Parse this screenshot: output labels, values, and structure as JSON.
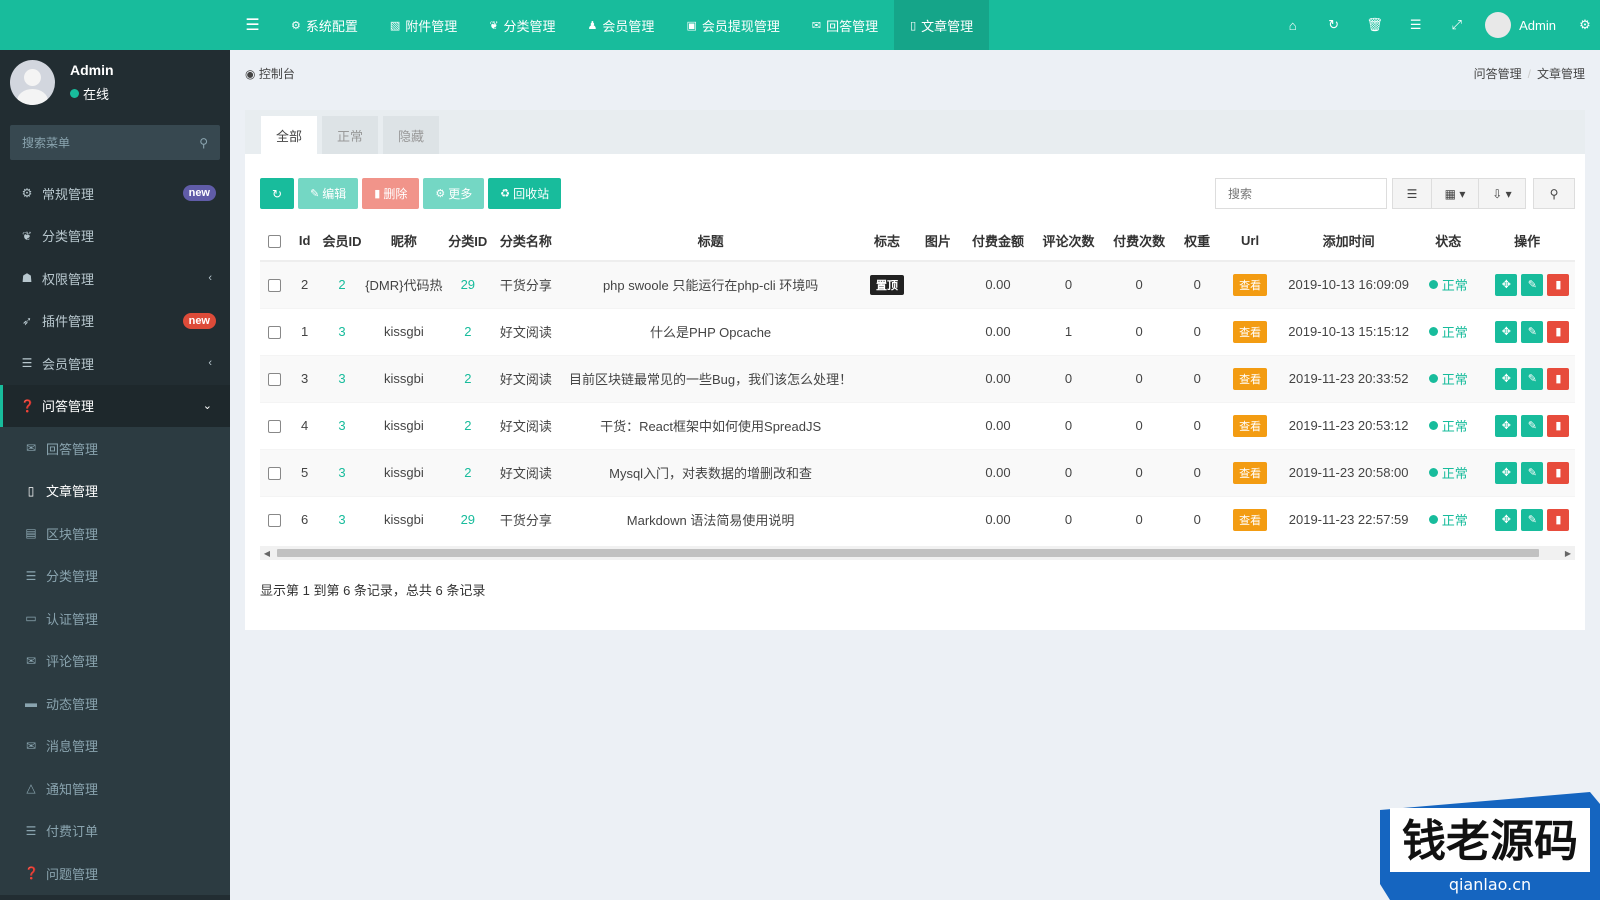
{
  "theme": {
    "primary": "#18bc9c",
    "sidebar_bg": "#222d32",
    "badge_new": "#605ca8",
    "badge_red": "#dd4b39",
    "warning": "#f39c12",
    "danger": "#e74c3c"
  },
  "header": {
    "tabs": [
      {
        "label": "系统配置",
        "icon": "gear-icon"
      },
      {
        "label": "附件管理",
        "icon": "file-image-icon"
      },
      {
        "label": "分类管理",
        "icon": "leaf-icon"
      },
      {
        "label": "会员管理",
        "icon": "user-icon"
      },
      {
        "label": "会员提现管理",
        "icon": "money-icon"
      },
      {
        "label": "回答管理",
        "icon": "comment-icon"
      },
      {
        "label": "文章管理",
        "icon": "file-icon"
      }
    ],
    "active_tab": "文章管理",
    "admin_name": "Admin"
  },
  "sidebar": {
    "user_name": "Admin",
    "user_status": "在线",
    "search_placeholder": "搜索菜单",
    "items": [
      {
        "label": "常规管理",
        "icon": "cogs-icon",
        "badge": "new"
      },
      {
        "label": "分类管理",
        "icon": "leaf-icon"
      },
      {
        "label": "权限管理",
        "icon": "group-icon"
      },
      {
        "label": "插件管理",
        "icon": "rocket-icon",
        "badge": "new"
      },
      {
        "label": "会员管理",
        "icon": "list-icon"
      },
      {
        "label": "问答管理",
        "icon": "question-icon"
      }
    ],
    "subitems": [
      {
        "label": "回答管理",
        "icon": "comment-icon"
      },
      {
        "label": "文章管理",
        "icon": "file-icon"
      },
      {
        "label": "区块管理",
        "icon": "block-icon"
      },
      {
        "label": "分类管理",
        "icon": "list-icon"
      },
      {
        "label": "认证管理",
        "icon": "id-card-icon"
      },
      {
        "label": "评论管理",
        "icon": "comments-icon"
      },
      {
        "label": "动态管理",
        "icon": "feed-icon"
      },
      {
        "label": "消息管理",
        "icon": "message-icon"
      },
      {
        "label": "通知管理",
        "icon": "bell-icon"
      },
      {
        "label": "付费订单",
        "icon": "list-icon"
      },
      {
        "label": "问题管理",
        "icon": "question-icon"
      }
    ]
  },
  "content": {
    "page_label": "控制台",
    "breadcrumb": [
      "问答管理",
      "文章管理"
    ],
    "tabs": [
      "全部",
      "正常",
      "隐藏"
    ],
    "toolbar": {
      "edit": "编辑",
      "delete": "删除",
      "more": "更多",
      "recycle": "回收站"
    },
    "search_placeholder": "搜索",
    "columns": [
      "Id",
      "会员ID",
      "昵称",
      "分类ID",
      "分类名称",
      "标题",
      "标志",
      "图片",
      "付费金额",
      "评论次数",
      "付费次数",
      "权重",
      "Url",
      "添加时间",
      "状态",
      "操作"
    ],
    "rows": [
      {
        "id": "2",
        "member_id": "2",
        "nickname": "{DMR}代码热",
        "cat_id": "29",
        "cat_name": "干货分享",
        "title": "php swoole 只能运行在php-cli 环境吗",
        "flag": "置顶",
        "amount": "0.00",
        "comments": "0",
        "paid": "0",
        "weight": "0",
        "url": "查看",
        "time": "2019-10-13 16:09:09",
        "status": "正常"
      },
      {
        "id": "1",
        "member_id": "3",
        "nickname": "kissgbi",
        "cat_id": "2",
        "cat_name": "好文阅读",
        "title": "什么是PHP Opcache",
        "flag": "",
        "amount": "0.00",
        "comments": "1",
        "paid": "0",
        "weight": "0",
        "url": "查看",
        "time": "2019-10-13 15:15:12",
        "status": "正常"
      },
      {
        "id": "3",
        "member_id": "3",
        "nickname": "kissgbi",
        "cat_id": "2",
        "cat_name": "好文阅读",
        "title": "目前区块链最常见的一些Bug，我们该怎么处理！",
        "flag": "",
        "amount": "0.00",
        "comments": "0",
        "paid": "0",
        "weight": "0",
        "url": "查看",
        "time": "2019-11-23 20:33:52",
        "status": "正常"
      },
      {
        "id": "4",
        "member_id": "3",
        "nickname": "kissgbi",
        "cat_id": "2",
        "cat_name": "好文阅读",
        "title": "干货：React框架中如何使用SpreadJS",
        "flag": "",
        "amount": "0.00",
        "comments": "0",
        "paid": "0",
        "weight": "0",
        "url": "查看",
        "time": "2019-11-23 20:53:12",
        "status": "正常"
      },
      {
        "id": "5",
        "member_id": "3",
        "nickname": "kissgbi",
        "cat_id": "2",
        "cat_name": "好文阅读",
        "title": "Mysql入门，对表数据的增删改和查",
        "flag": "",
        "amount": "0.00",
        "comments": "0",
        "paid": "0",
        "weight": "0",
        "url": "查看",
        "time": "2019-11-23 20:58:00",
        "status": "正常"
      },
      {
        "id": "6",
        "member_id": "3",
        "nickname": "kissgbi",
        "cat_id": "29",
        "cat_name": "干货分享",
        "title": "Markdown 语法简易使用说明",
        "flag": "",
        "amount": "0.00",
        "comments": "0",
        "paid": "0",
        "weight": "0",
        "url": "查看",
        "time": "2019-11-23 22:57:59",
        "status": "正常"
      }
    ],
    "pagination_info": "显示第 1 到第 6 条记录，总共 6 条记录"
  },
  "watermark": {
    "brand": "钱老源码",
    "domain": "qianlao.cn"
  }
}
